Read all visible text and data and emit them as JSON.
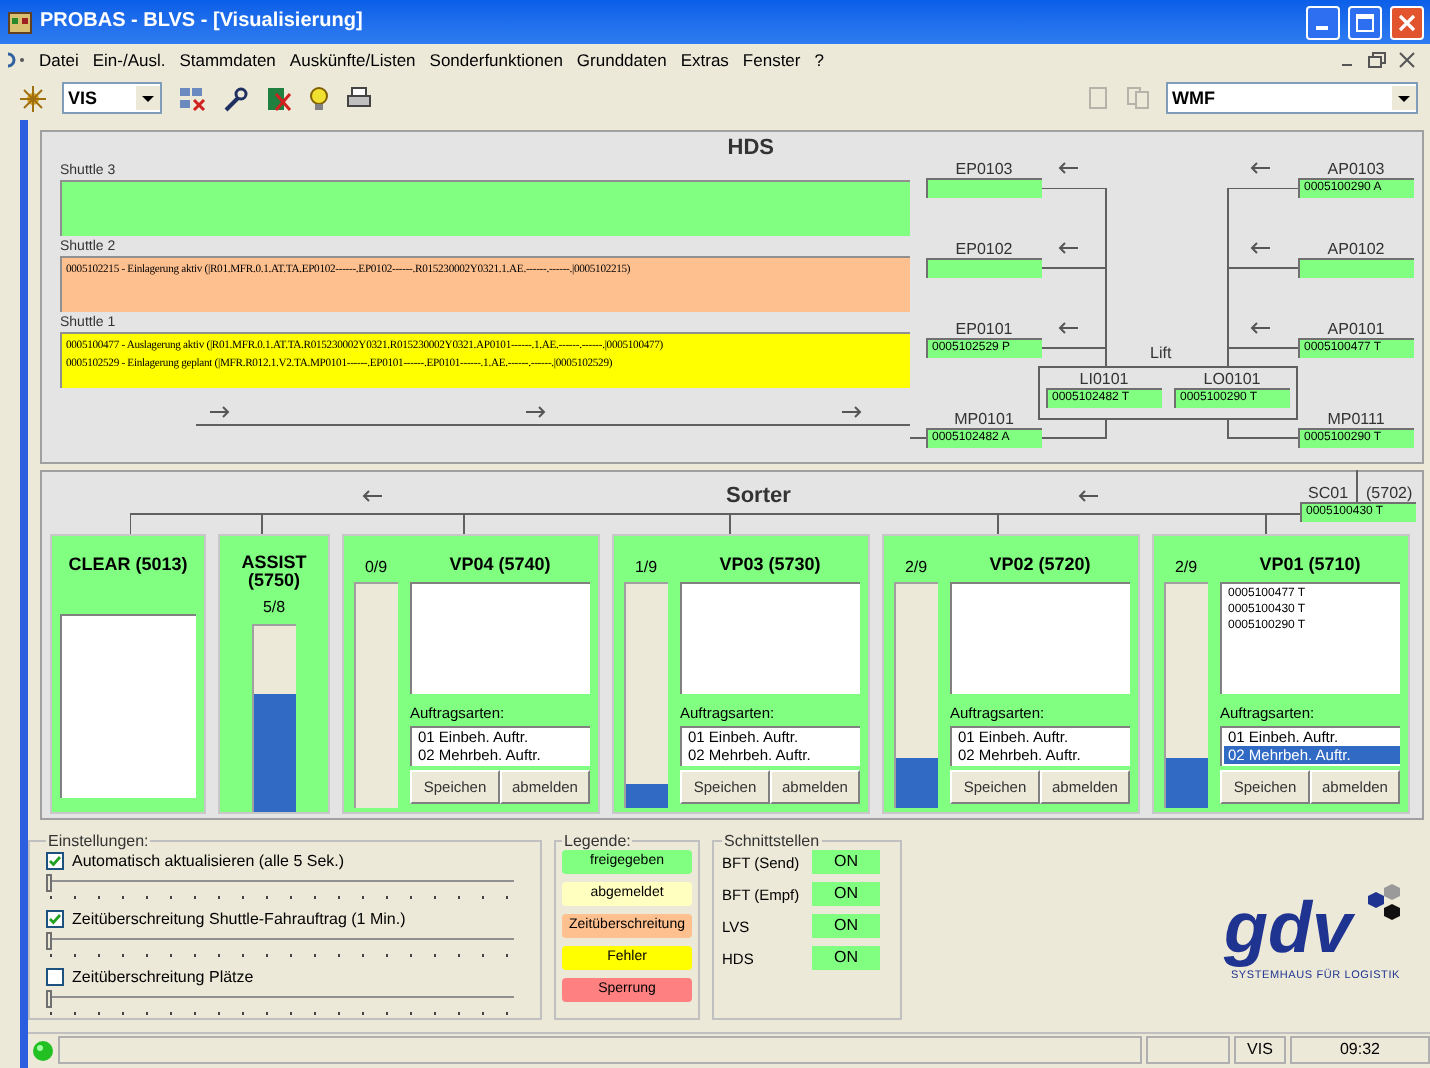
{
  "window": {
    "title": "PROBAS - BLVS - [Visualisierung]"
  },
  "menu": [
    "Datei",
    "Ein-/Ausl.",
    "Stammdaten",
    "Auskünfte/Listen",
    "Sonderfunktionen",
    "Grunddaten",
    "Extras",
    "Fenster",
    "?"
  ],
  "toolbar": {
    "view_select": "VIS",
    "format_select": "WMF"
  },
  "hds": {
    "title": "HDS",
    "shuttles": [
      {
        "label": "Shuttle 3",
        "color": "#80ff80"
      },
      {
        "label": "Shuttle 2",
        "color": "#ffc090",
        "lines": [
          "0005102215 - Einlagerung aktiv (|R01.MFR.0.1.AT.TA.EP0102------.EP0102------.R015230002Y0321.1.AE.------.------.|0005102215)"
        ]
      },
      {
        "label": "Shuttle 1",
        "color": "#ffff00",
        "lines": [
          "0005100477 - Auslagerung aktiv (|R01.MFR.0.1.AT.TA.R015230002Y0321.R015230002Y0321.AP0101------.1.AE.------.------.|0005100477)",
          "0005102529 - Einlagerung geplant (|MFR.R012.1.V2.TA.MP0101------.EP0101------.EP0101------.1.AE.------.------.|0005102529)"
        ]
      }
    ],
    "nodes": [
      {
        "label": "EP0103"
      },
      {
        "label": "EP0102"
      },
      {
        "label": "EP0101",
        "value": "0005102529 P"
      },
      {
        "label": "MP0101",
        "value": "0005102482 A"
      },
      {
        "label": "AP0103",
        "value": "0005100290 A"
      },
      {
        "label": "AP0102"
      },
      {
        "label": "AP0101",
        "value": "0005100477 T"
      },
      {
        "label": "MP0111",
        "value": "0005100290 T"
      }
    ],
    "lift": {
      "label": "Lift",
      "nodes": [
        {
          "label": "LI0101",
          "value": "0005102482 T"
        },
        {
          "label": "LO0101",
          "value": "0005100290 T"
        }
      ]
    }
  },
  "sorter": {
    "title": "Sorter",
    "sc": {
      "label": "SC01",
      "number": "(5702)",
      "value": "0005100430 T"
    },
    "stations": [
      {
        "kind": "clear",
        "title": "CLEAR (5013)"
      },
      {
        "kind": "assist",
        "title": "ASSIST (5750)",
        "count": "5/8",
        "level": 0.63
      },
      {
        "kind": "vp",
        "title": "VP04 (5740)",
        "count": "0/9",
        "level": 0,
        "order_types_label": "Auftragsarten:",
        "order_types": [
          {
            "label": "01 Einbeh. Auftr.",
            "selected": false
          },
          {
            "label": "02 Mehrbeh. Auftr.",
            "selected": false
          }
        ],
        "buttons": [
          "Speichen",
          "abmelden"
        ]
      },
      {
        "kind": "vp",
        "title": "VP03 (5730)",
        "count": "1/9",
        "level": 0.11,
        "order_types_label": "Auftragsarten:",
        "order_types": [
          {
            "label": "01 Einbeh. Auftr.",
            "selected": false
          },
          {
            "label": "02 Mehrbeh. Auftr.",
            "selected": false
          }
        ],
        "buttons": [
          "Speichen",
          "abmelden"
        ]
      },
      {
        "kind": "vp",
        "title": "VP02 (5720)",
        "count": "2/9",
        "level": 0.22,
        "order_types_label": "Auftragsarten:",
        "order_types": [
          {
            "label": "01 Einbeh. Auftr.",
            "selected": false
          },
          {
            "label": "02 Mehrbeh. Auftr.",
            "selected": false
          }
        ],
        "buttons": [
          "Speichen",
          "abmelden"
        ]
      },
      {
        "kind": "vp",
        "title": "VP01 (5710)",
        "count": "2/9",
        "level": 0.22,
        "items": [
          "0005100477 T",
          "0005100430 T",
          "0005100290 T"
        ],
        "order_types_label": "Auftragsarten:",
        "order_types": [
          {
            "label": "01 Einbeh. Auftr.",
            "selected": false
          },
          {
            "label": "02 Mehrbeh. Auftr.",
            "selected": true
          }
        ],
        "buttons": [
          "Speichen",
          "abmelden"
        ]
      }
    ]
  },
  "settings": {
    "title": "Einstellungen:",
    "items": [
      {
        "label": "Automatisch aktualisieren (alle 5 Sek.)",
        "checked": true,
        "level": 0
      },
      {
        "label": "Zeitüberschreitung Shuttle-Fahrauftrag (1 Min.)",
        "checked": true,
        "level": 0
      },
      {
        "label": "Zeitüberschreitung Plätze",
        "checked": false,
        "level": 0
      }
    ]
  },
  "legend": {
    "title": "Legende:",
    "items": [
      {
        "label": "freigegeben",
        "color": "#80ff80"
      },
      {
        "label": "abgemeldet",
        "color": "#ffffc0"
      },
      {
        "label": "Zeitüberschreitung",
        "color": "#ffc090"
      },
      {
        "label": "Fehler",
        "color": "#ffff00"
      },
      {
        "label": "Sperrung",
        "color": "#ff8080"
      }
    ]
  },
  "interfaces": {
    "title": "Schnittstellen",
    "items": [
      {
        "label": "BFT (Send)",
        "status": "ON"
      },
      {
        "label": "BFT (Empf)",
        "status": "ON"
      },
      {
        "label": "LVS",
        "status": "ON"
      },
      {
        "label": "HDS",
        "status": "ON"
      }
    ]
  },
  "logo": {
    "name": "gdv",
    "tagline": "SYSTEMHAUS FÜR LOGISTIK"
  },
  "status_bar": {
    "fields": [
      "VIS",
      "09:32"
    ]
  }
}
